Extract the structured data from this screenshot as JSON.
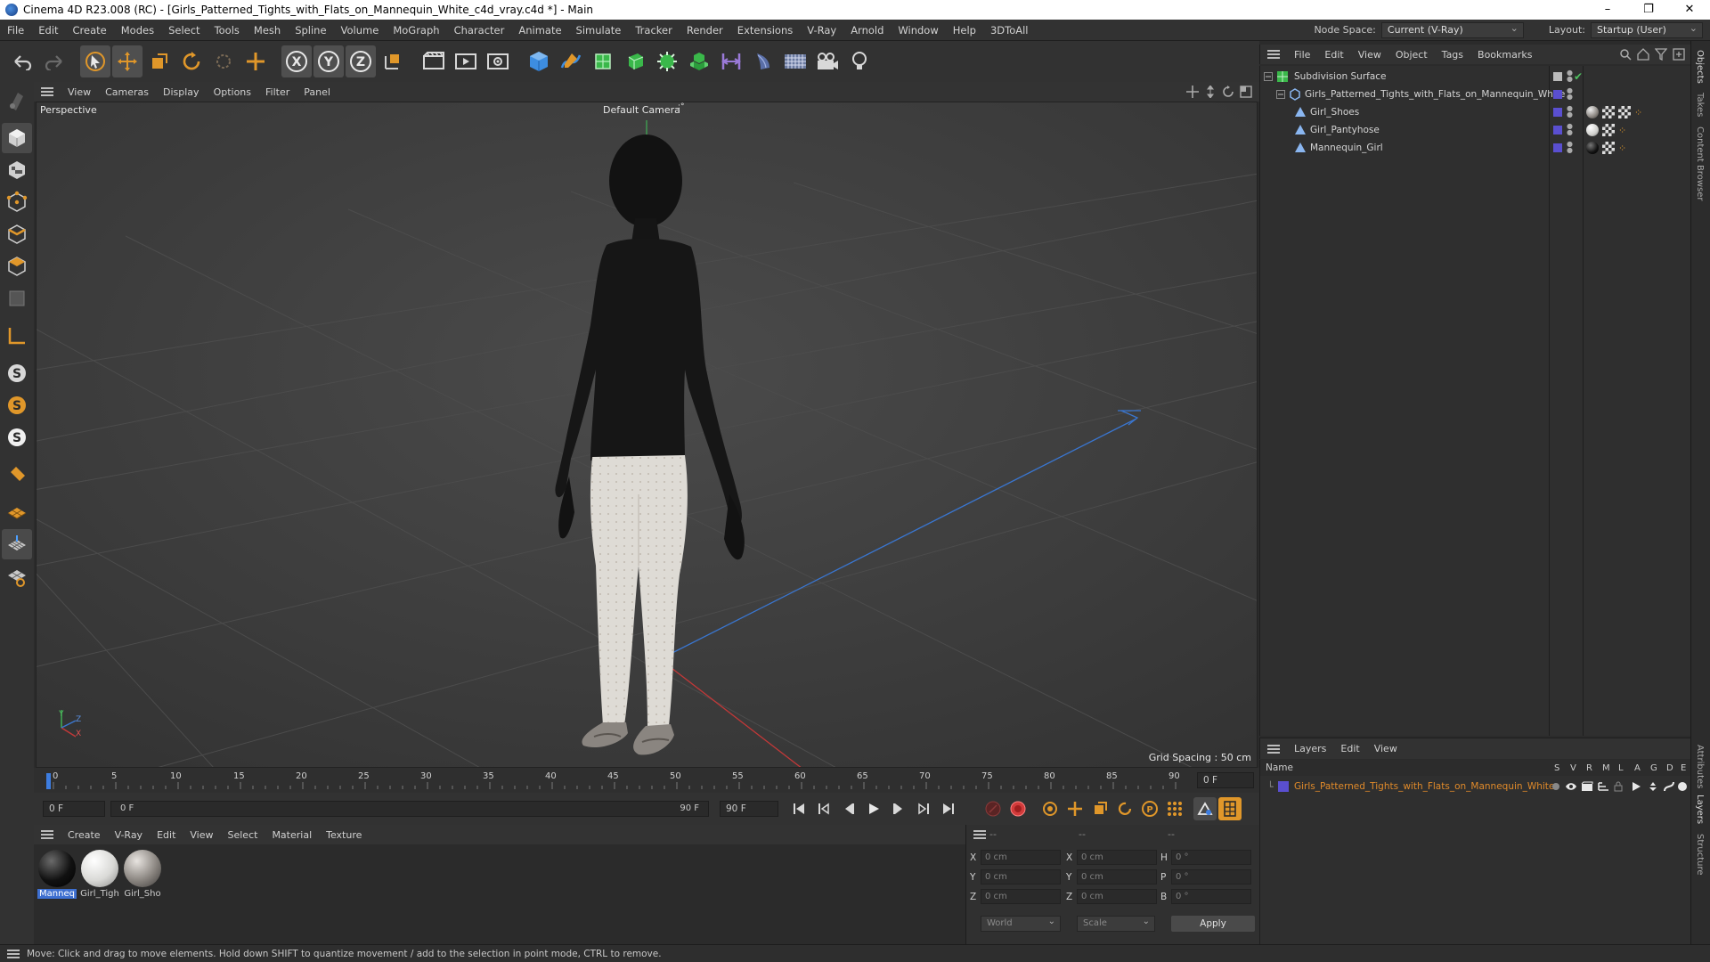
{
  "window": {
    "title": "Cinema 4D R23.008 (RC) - [Girls_Patterned_Tights_with_Flats_on_Mannequin_White_c4d_vray.c4d *] - Main",
    "controls": [
      "–",
      "❐",
      "✕"
    ]
  },
  "menubar": {
    "items": [
      "File",
      "Edit",
      "Create",
      "Modes",
      "Select",
      "Tools",
      "Mesh",
      "Spline",
      "Volume",
      "MoGraph",
      "Character",
      "Animate",
      "Simulate",
      "Tracker",
      "Render",
      "Extensions",
      "V-Ray",
      "Arnold",
      "Window",
      "Help",
      "3DToAll"
    ],
    "node_space_label": "Node Space:",
    "node_space_value": "Current (V-Ray)",
    "layout_label": "Layout:",
    "layout_value": "Startup (User)"
  },
  "viewport": {
    "menu": [
      "View",
      "Cameras",
      "Display",
      "Options",
      "Filter",
      "Panel"
    ],
    "view_name": "Perspective",
    "camera": "Default Camera",
    "camera_suffix": ":°",
    "grid_spacing": "Grid Spacing : 50 cm",
    "axis_x": "X",
    "axis_y": "Y",
    "axis_z": "Z"
  },
  "timeline": {
    "ticks": [
      "0",
      "5",
      "10",
      "15",
      "20",
      "25",
      "30",
      "35",
      "40",
      "45",
      "50",
      "55",
      "60",
      "65",
      "70",
      "75",
      "80",
      "85",
      "90"
    ],
    "current_frame": "0 F"
  },
  "transport": {
    "start_field": "0 F",
    "range_start": "0 F",
    "range_end": "90 F",
    "end_field": "90 F"
  },
  "materials": {
    "menu": [
      "Create",
      "V-Ray",
      "Edit",
      "View",
      "Select",
      "Material",
      "Texture"
    ],
    "items": [
      {
        "name": "Manneq",
        "color": "#111111"
      },
      {
        "name": "Girl_Tigh",
        "color": "#d9d9d6"
      },
      {
        "name": "Girl_Sho",
        "color": "#8a8580"
      }
    ]
  },
  "coordinates": {
    "header": [
      "--",
      "--",
      "--"
    ],
    "pos": [
      {
        "label": "X",
        "value": "0 cm"
      },
      {
        "label": "Y",
        "value": "0 cm"
      },
      {
        "label": "Z",
        "value": "0 cm"
      }
    ],
    "size": [
      {
        "label": "X",
        "value": "0 cm"
      },
      {
        "label": "Y",
        "value": "0 cm"
      },
      {
        "label": "Z",
        "value": "0 cm"
      }
    ],
    "rot": [
      {
        "label": "H",
        "value": "0 °"
      },
      {
        "label": "P",
        "value": "0 °"
      },
      {
        "label": "B",
        "value": "0 °"
      }
    ],
    "space": "World",
    "mode": "Scale",
    "apply": "Apply"
  },
  "status": "Move: Click and drag to move elements. Hold down SHIFT to quantize movement / add to the selection in point mode, CTRL to remove.",
  "objects": {
    "menu": [
      "File",
      "Edit",
      "View",
      "Object",
      "Tags",
      "Bookmarks"
    ],
    "rows": [
      {
        "name": "Subdivision Surface",
        "icon": "subdivision-icon"
      },
      {
        "name": "Girls_Patterned_Tights_with_Flats_on_Mannequin_White",
        "icon": "null-object-icon"
      },
      {
        "name": "Girl_Shoes",
        "icon": "polygon-object-icon"
      },
      {
        "name": "Girl_Pantyhose",
        "icon": "polygon-object-icon"
      },
      {
        "name": "Mannequin_Girl",
        "icon": "polygon-object-icon"
      }
    ]
  },
  "layers": {
    "menu": [
      "Layers",
      "Edit",
      "View"
    ],
    "header_name": "Name",
    "flags": [
      "S",
      "V",
      "R",
      "M",
      "L",
      "A",
      "G",
      "D",
      "E"
    ],
    "rows": [
      {
        "name": "Girls_Patterned_Tights_with_Flats_on_Mannequin_White",
        "color": "#5a4fd0"
      }
    ]
  },
  "side_tabs": [
    "Objects",
    "Takes",
    "Content Browser",
    "Attributes",
    "Layers",
    "Structure"
  ],
  "colors": {
    "accent_blue": "#3d7de0",
    "layer_text": "#e08a2a",
    "record": "#d23b3b"
  }
}
